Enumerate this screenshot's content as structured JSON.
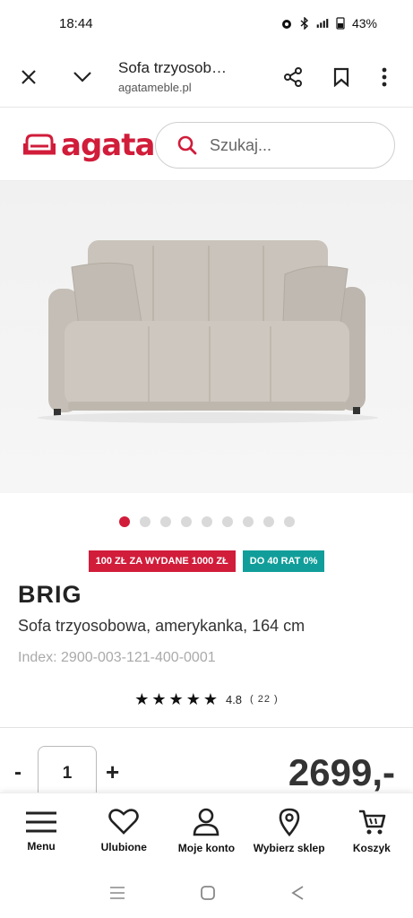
{
  "status_bar": {
    "time": "18:44",
    "battery": "43%"
  },
  "tab_bar": {
    "title": "Sofa trzyosob…",
    "url": "agatameble.pl",
    "icons": [
      "close-icon",
      "chevron-down-icon",
      "share-icon",
      "bookmark-icon",
      "more-vert-icon"
    ]
  },
  "site_header": {
    "logo_text": "agata",
    "search_placeholder": "Szukaj..."
  },
  "carousel": {
    "total": 9,
    "active": 0
  },
  "badges": [
    {
      "label": "100 ZŁ ZA WYDANE 1000 ZŁ",
      "color": "#d11c3a"
    },
    {
      "label": "DO 40 RAT 0%",
      "color": "#119e9a"
    }
  ],
  "product": {
    "name": "BRIG",
    "description": "Sofa trzyosobowa, amerykanka, 164 cm",
    "index": "Index: 2900-003-121-400-0001",
    "rating": {
      "score": "4.8",
      "count": "( 22 )",
      "stars": 5
    }
  },
  "purchase": {
    "minus": "-",
    "quantity": "1",
    "plus": "+",
    "price": "2699,-"
  },
  "bottom_nav": [
    {
      "label": "Menu",
      "icon": "menu-icon"
    },
    {
      "label": "Ulubione",
      "icon": "heart-icon"
    },
    {
      "label": "Moje konto",
      "icon": "user-icon"
    },
    {
      "label": "Wybierz sklep",
      "icon": "location-pin-icon"
    },
    {
      "label": "Koszyk",
      "icon": "cart-icon"
    }
  ],
  "colors": {
    "brand": "#d11c3a",
    "teal": "#119e9a"
  }
}
